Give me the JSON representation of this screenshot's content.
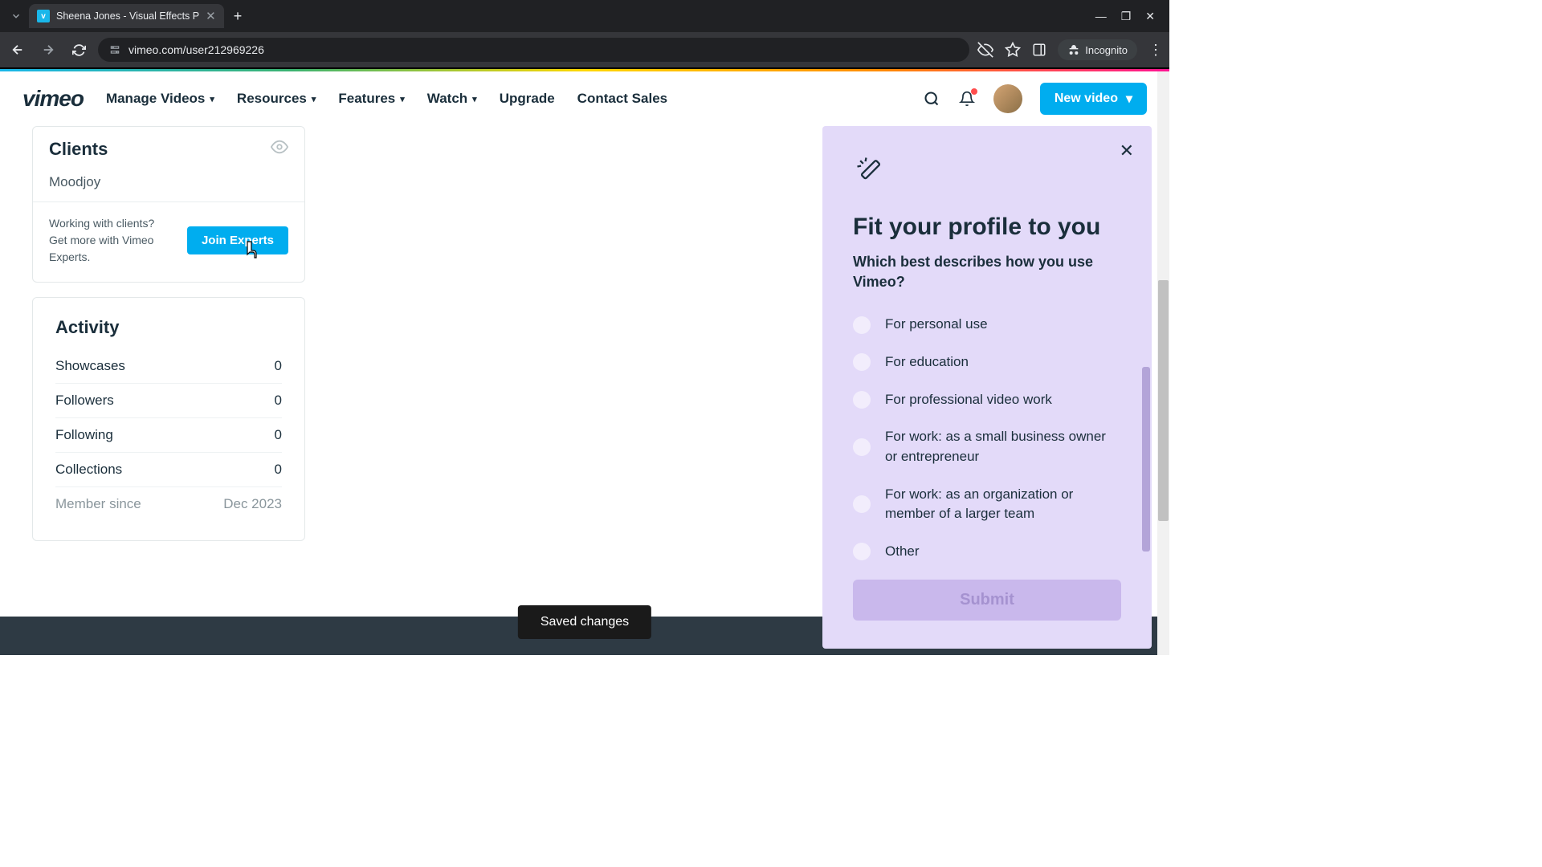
{
  "browser": {
    "tab_title": "Sheena Jones - Visual Effects P",
    "url": "vimeo.com/user212969226",
    "incognito_label": "Incognito"
  },
  "nav": {
    "logo": "vimeo",
    "items": [
      "Manage Videos",
      "Resources",
      "Features",
      "Watch",
      "Upgrade",
      "Contact Sales"
    ],
    "new_video": "New video"
  },
  "clients": {
    "title": "Clients",
    "entry": "Moodjoy",
    "pitch": "Working with clients? Get more with Vimeo Experts.",
    "cta": "Join Experts"
  },
  "activity": {
    "title": "Activity",
    "rows": [
      {
        "label": "Showcases",
        "value": "0"
      },
      {
        "label": "Followers",
        "value": "0"
      },
      {
        "label": "Following",
        "value": "0"
      },
      {
        "label": "Collections",
        "value": "0"
      },
      {
        "label": "Member since",
        "value": "Dec 2023"
      }
    ]
  },
  "toast": "Saved changes",
  "panel": {
    "title": "Fit your profile to you",
    "subtitle": "Which best describes how you use Vimeo?",
    "options": [
      "For personal use",
      "For education",
      "For professional video work",
      "For work: as a small business owner or entrepreneur",
      "For work: as an organization or member of a larger team",
      "Other"
    ],
    "submit": "Submit"
  }
}
